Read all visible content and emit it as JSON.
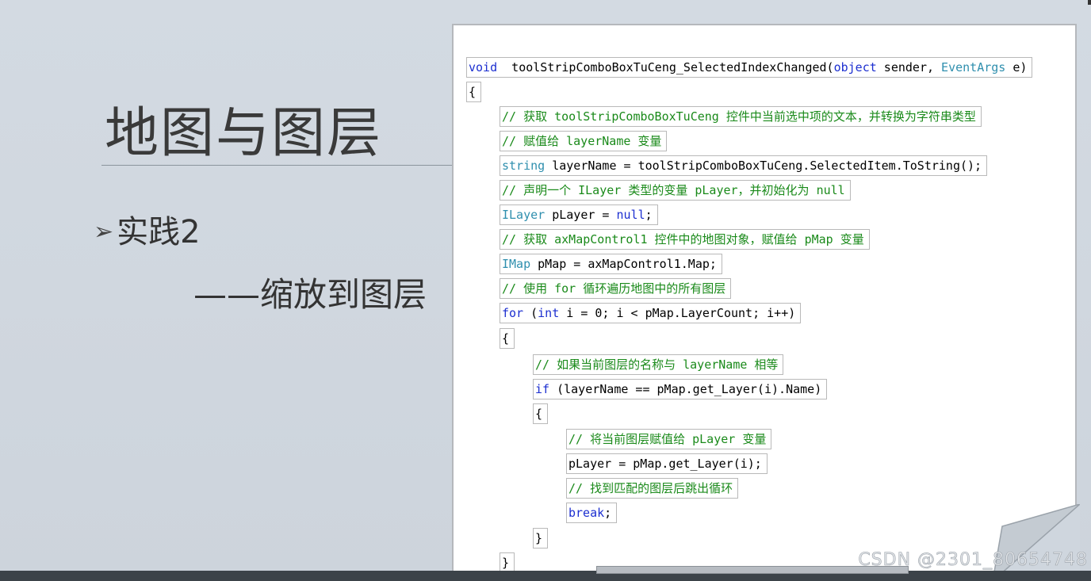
{
  "slide": {
    "title": "地图与图层",
    "bullet_marker": "➢",
    "bullet_text": "实践2",
    "subtitle": "——缩放到图层"
  },
  "code": {
    "lines": [
      {
        "parts": [
          [
            "kw",
            "void"
          ],
          [
            "",
            "  toolStripComboBoxTuCeng_SelectedIndexChanged("
          ],
          [
            "kw",
            "object"
          ],
          [
            "",
            " sender, "
          ],
          [
            "ty",
            "EventArgs"
          ],
          [
            "",
            " e)"
          ]
        ],
        "boxed": true
      },
      {
        "parts": [
          [
            "",
            "{"
          ]
        ],
        "boxed": true
      },
      {
        "parts": [
          [
            "cm",
            "// 获取 toolStripComboBoxTuCeng 控件中当前选中项的文本，并转换为字符串类型"
          ]
        ],
        "boxed": true
      },
      {
        "parts": [
          [
            "cm",
            "// 赋值给 layerName 变量"
          ]
        ],
        "boxed": true
      },
      {
        "parts": [
          [
            "ty",
            "string"
          ],
          [
            "",
            " layerName = toolStripComboBoxTuCeng.SelectedItem.ToString();"
          ]
        ],
        "boxed": true
      },
      {
        "parts": [
          [
            "cm",
            "// 声明一个 ILayer 类型的变量 pLayer，并初始化为 null"
          ]
        ],
        "boxed": true
      },
      {
        "parts": [
          [
            "ty",
            "ILayer"
          ],
          [
            "",
            " pLayer = "
          ],
          [
            "kw",
            "null"
          ],
          [
            "",
            ";"
          ]
        ],
        "boxed": true
      },
      {
        "parts": [
          [
            "cm",
            "// 获取 axMapControl1 控件中的地图对象，赋值给 pMap 变量"
          ]
        ],
        "boxed": true
      },
      {
        "parts": [
          [
            "ty",
            "IMap"
          ],
          [
            "",
            " pMap = axMapControl1.Map;"
          ]
        ],
        "boxed": true
      },
      {
        "parts": [
          [
            "cm",
            "// 使用 for 循环遍历地图中的所有图层"
          ]
        ],
        "boxed": true
      },
      {
        "parts": [
          [
            "kw",
            "for"
          ],
          [
            "",
            " ("
          ],
          [
            "kw",
            "int"
          ],
          [
            "",
            " i = 0; i < pMap.LayerCount; i++)"
          ]
        ],
        "boxed": true
      },
      {
        "parts": [
          [
            "",
            "{"
          ]
        ],
        "boxed": true
      },
      {
        "parts": [
          [
            "cm",
            "// 如果当前图层的名称与 layerName 相等"
          ]
        ],
        "boxed": true
      },
      {
        "parts": [
          [
            "kw",
            "if"
          ],
          [
            "",
            " (layerName == pMap.get_Layer(i).Name)"
          ]
        ],
        "boxed": true
      },
      {
        "parts": [
          [
            "",
            "{"
          ]
        ],
        "boxed": true
      },
      {
        "parts": [
          [
            "cm",
            "// 将当前图层赋值给 pLayer 变量"
          ]
        ],
        "boxed": true
      },
      {
        "parts": [
          [
            "",
            "pLayer = pMap.get_Layer(i);"
          ]
        ],
        "boxed": true
      },
      {
        "parts": [
          [
            "cm",
            "// 找到匹配的图层后跳出循环"
          ]
        ],
        "boxed": true
      },
      {
        "parts": [
          [
            "kw",
            "break"
          ],
          [
            "",
            ";"
          ]
        ],
        "boxed": true
      },
      {
        "parts": [
          [
            "",
            "}"
          ]
        ],
        "boxed": true
      },
      {
        "parts": [
          [
            "",
            "}"
          ]
        ],
        "boxed": true
      }
    ]
  },
  "watermark": "CSDN @2301_80654748",
  "colors": {
    "comment": "#1a8a1a",
    "keyword": "#1c2fd0",
    "type": "#2f8fae",
    "background": "#cfd6de"
  }
}
